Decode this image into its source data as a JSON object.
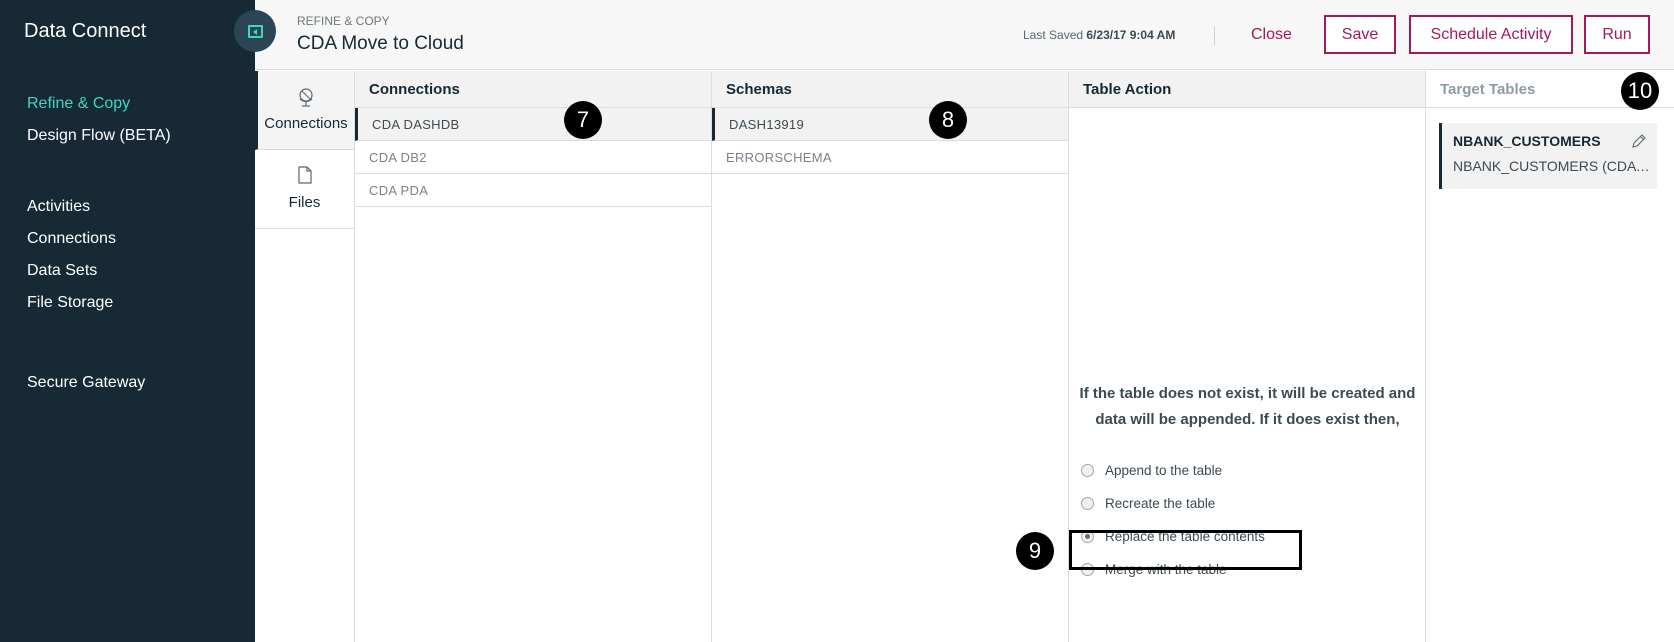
{
  "sidebar": {
    "app_name": "Data Connect",
    "primary_items": [
      {
        "label": "Refine & Copy",
        "active": true
      },
      {
        "label": "Design Flow (BETA)",
        "active": false
      }
    ],
    "secondary_items": [
      {
        "label": "Activities"
      },
      {
        "label": "Connections"
      },
      {
        "label": "Data Sets"
      },
      {
        "label": "File Storage"
      }
    ],
    "tertiary_items": [
      {
        "label": "Secure Gateway"
      }
    ],
    "collapse_icon": "collapse-panel-icon"
  },
  "header": {
    "breadcrumb": "REFINE & COPY",
    "title": "CDA Move to Cloud",
    "last_saved_label": "Last Saved",
    "last_saved_value": "6/23/17 9:04 AM",
    "close_label": "Close",
    "save_label": "Save",
    "schedule_label": "Schedule Activity",
    "run_label": "Run"
  },
  "source_tabs": [
    {
      "label": "Connections",
      "icon": "globe-icon",
      "active": true
    },
    {
      "label": "Files",
      "icon": "file-icon",
      "active": false
    }
  ],
  "connections": {
    "header": "Connections",
    "items": [
      "CDA DASHDB",
      "CDA DB2",
      "CDA PDA"
    ],
    "selected_index": 0
  },
  "schemas": {
    "header": "Schemas",
    "items": [
      "DASH13919",
      "ERRORSCHEMA"
    ],
    "selected_index": 0
  },
  "table_action": {
    "header": "Table Action",
    "message": "If the table does not exist, it will be created and data will be appended. If it does exist then,",
    "options": [
      "Append to the table",
      "Recreate the table",
      "Replace the table contents",
      "Merge with the table"
    ],
    "selected_index": 2
  },
  "target_tables": {
    "header": "Target Tables",
    "items": [
      {
        "name": "NBANK_CUSTOMERS",
        "detail": "NBANK_CUSTOMERS (CDA DASHDB)",
        "icon": "pencil-icon"
      }
    ]
  },
  "callouts": [
    "7",
    "8",
    "9",
    "10"
  ],
  "colors": {
    "sidebar_bg": "#162935",
    "accent_teal": "#41d6c3",
    "brand_magenta": "#a3195b",
    "text_dark": "#152935"
  }
}
